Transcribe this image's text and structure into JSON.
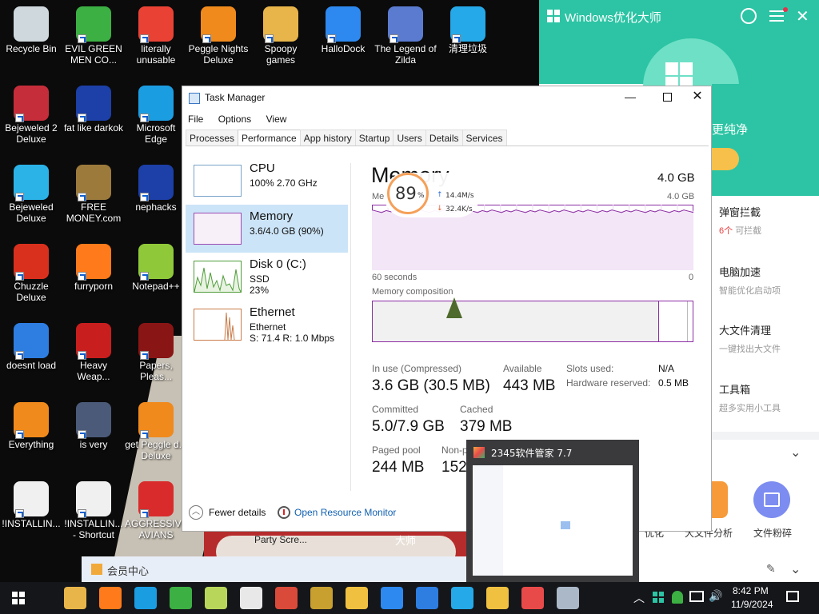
{
  "desktop_icons": [
    {
      "label": "Recycle Bin",
      "icon": "recycle-bin-icon",
      "color": "#cfd8dc"
    },
    {
      "label": "EVIL GREEN MEN CO...",
      "icon": "green-men-icon",
      "color": "#3cb043"
    },
    {
      "label": "literally unusable",
      "icon": "chrome-icon",
      "color": "#e94235"
    },
    {
      "label": "Peggle Nights Deluxe",
      "icon": "peggle-icon",
      "color": "#f08a1c"
    },
    {
      "label": "Spoopy games",
      "icon": "folder-icon",
      "color": "#e8b54a"
    },
    {
      "label": "HalloDock",
      "icon": "windows-shield-icon",
      "color": "#2d89ef"
    },
    {
      "label": "The Legend of Zilda",
      "icon": "zilda-icon",
      "color": "#5a7bd0"
    },
    {
      "label": "清理垃圾",
      "icon": "trash-icon",
      "color": "#25a9e8"
    },
    {
      "label": "Bejeweled 2 Deluxe",
      "icon": "bejeweled2-icon",
      "color": "#c62d3a"
    },
    {
      "label": "fat like darkok",
      "icon": "mpi-icon",
      "color": "#1c3fa8"
    },
    {
      "label": "Microsoft Edge",
      "icon": "edge-icon",
      "color": "#1b9de2"
    },
    {
      "label": "Bejeweled Deluxe",
      "icon": "bejeweled-icon",
      "color": "#2bb3e8"
    },
    {
      "label": "FREE MONEY.com",
      "icon": "money-bag-icon",
      "color": "#9c7a3c"
    },
    {
      "label": "nephacks",
      "icon": "mpi-icon",
      "color": "#1c3fa8"
    },
    {
      "label": "Chuzzle Deluxe",
      "icon": "chuzzle-icon",
      "color": "#d9301e"
    },
    {
      "label": "furryporn",
      "icon": "firefox-icon",
      "color": "#ff7a1a"
    },
    {
      "label": "Notepad++",
      "icon": "notepadpp-icon",
      "color": "#8fc93a"
    },
    {
      "label": "doesnt load",
      "icon": "thunderbird-icon",
      "color": "#2e7de1"
    },
    {
      "label": "Heavy Weap...",
      "icon": "radiation-icon",
      "color": "#c81e1e"
    },
    {
      "label": "Papers, Pleas...",
      "icon": "papers-icon",
      "color": "#8a1515"
    },
    {
      "label": "Everything",
      "icon": "search-icon",
      "color": "#f08a1c"
    },
    {
      "label": "is very",
      "icon": "mpi-shield-icon",
      "color": "#4a5a78"
    },
    {
      "label": "get Peggle d... Deluxe",
      "icon": "peggle-icon",
      "color": "#f08a1c"
    },
    {
      "label": "!INSTALLIN...",
      "icon": "document-icon",
      "color": "#f0f0f0"
    },
    {
      "label": "!INSTALLIN... - Shortcut",
      "icon": "document-icon",
      "color": "#f0f0f0"
    },
    {
      "label": "AGGRESSIVE AVIANS",
      "icon": "angry-bird-icon",
      "color": "#d92b2b"
    }
  ],
  "optimizer": {
    "title": "Windows优化大师",
    "clean_text": "更纯净",
    "features": [
      {
        "title": "弹窗拦截",
        "sub_count": "6个",
        "sub": "可拦截"
      },
      {
        "title": "电脑加速",
        "sub": "智能优化启动项"
      },
      {
        "title": "大文件清理",
        "sub": "一键找出大文件"
      },
      {
        "title": "工具箱",
        "sub": "超多实用小工具"
      }
    ],
    "tools": [
      "大文件分析",
      "文件粉碎"
    ],
    "tool_partial": "优化",
    "vip": "会员中心",
    "bottom_partial": "大师",
    "accent": "#2cc4a4"
  },
  "task_manager": {
    "title": "Task Manager",
    "menu": [
      "File",
      "Options",
      "View"
    ],
    "tabs": [
      "Processes",
      "Performance",
      "App history",
      "Startup",
      "Users",
      "Details",
      "Services"
    ],
    "sidebar": [
      {
        "name": "CPU",
        "d1": "100%  2.70 GHz",
        "d2": ""
      },
      {
        "name": "Memory",
        "d1": "3.6/4.0 GB (90%)",
        "d2": ""
      },
      {
        "name": "Disk 0 (C:)",
        "d1": "SSD",
        "d2": "23%"
      },
      {
        "name": "Ethernet",
        "d1": "Ethernet",
        "d2": "S: 71.4  R: 1.0 Mbps"
      }
    ],
    "heading": "Memory",
    "total": "4.0 GB",
    "usage_label": "Me",
    "graph_max": "4.0 GB",
    "time_left": "60 seconds",
    "time_right": "0",
    "composition_label": "Memory composition",
    "stats": [
      {
        "label": "In use (Compressed)",
        "value": "3.6 GB (30.5 MB)"
      },
      {
        "label": "Available",
        "value": "443 MB"
      },
      {
        "label": "Committed",
        "value": "5.0/7.9 GB"
      },
      {
        "label": "Cached",
        "value": "379 MB"
      },
      {
        "label": "Paged pool",
        "value": "244 MB"
      },
      {
        "label": "Non-p",
        "value": "152"
      }
    ],
    "side_stats": [
      {
        "label": "Slots used:",
        "value": "N/A"
      },
      {
        "label": "Hardware reserved:",
        "value": "0.5 MB"
      }
    ],
    "fewer_details": "Fewer details",
    "open_monitor": "Open Resource Monitor",
    "memory_usage_fraction": 0.9,
    "graph_color": "#8b2ca4"
  },
  "widget": {
    "percent": "89",
    "unit": "%",
    "up": "14.4M/s",
    "down": "32.4K/s"
  },
  "preview": {
    "title": "2345软件管家 7.7"
  },
  "taskbar": {
    "time": "8:42 PM",
    "date": "11/9/2024"
  }
}
